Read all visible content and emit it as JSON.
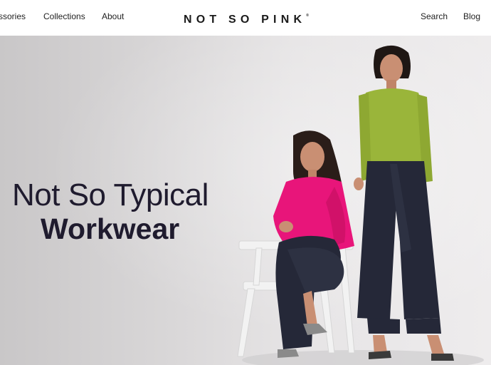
{
  "nav": {
    "left": [
      "ssories",
      "Collections",
      "About"
    ],
    "brand": "NOT SO PINK",
    "brand_mark": "®",
    "right": [
      "Search",
      "Blog"
    ]
  },
  "hero": {
    "line1": "Not So Typical",
    "line2": "Workwear"
  },
  "colors": {
    "heading": "#1f1b2e",
    "pink_shirt": "#e8157a",
    "green_shirt": "#9ab53a",
    "trousers": "#252838",
    "background": "#dcdadb"
  }
}
